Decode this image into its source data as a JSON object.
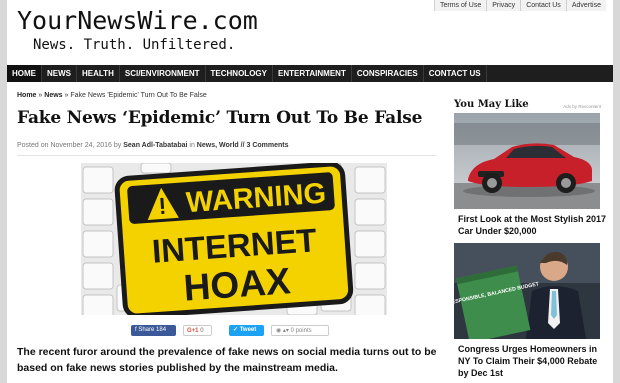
{
  "top_links": [
    "Terms of Use",
    "Privacy",
    "Contact Us",
    "Advertise"
  ],
  "logo": {
    "name": "YourNewsWire.com",
    "tagline": "News. Truth. Unfiltered."
  },
  "nav": [
    "HOME",
    "NEWS",
    "HEALTH",
    "SCI/ENVIRONMENT",
    "TECHNOLOGY",
    "ENTERTAINMENT",
    "CONSPIRACIES",
    "CONTACT US"
  ],
  "breadcrumb": {
    "home": "Home",
    "sep": "»",
    "news": "News",
    "current": "Fake News 'Epidemic' Turn Out To Be False"
  },
  "article": {
    "title": "Fake News ‘Epidemic’ Turn Out To Be False",
    "posted_on": "Posted on November 24, 2016 by",
    "author": "Sean Adl-Tabatabai",
    "in": "in",
    "categories": "News, World",
    "comments": "// 3 Comments",
    "image": {
      "line1": "WARNING",
      "line2": "INTERNET",
      "line3": "HOAX"
    },
    "lead": "The recent furor around the prevalence of fake news on social media turns out to be based on fake news stories published by the mainstream media."
  },
  "share": {
    "facebook_label": "Share",
    "facebook_count": "184",
    "gplus_label": "G+1",
    "gplus_count": "0",
    "tweet_label": "Tweet",
    "stumble_label": "0 points"
  },
  "sidebar": {
    "title": "You May Like",
    "ads_label": "Ads by Revcontent",
    "items": [
      {
        "caption": "First Look at the Most Stylish 2017 Car Under $20,000"
      },
      {
        "caption": "Congress Urges Homeowners in NY To Claim Their $4,000 Rebate by Dec 1st",
        "image_text": "A RESPONSIBLE, BALANCED BUDGET"
      }
    ]
  },
  "colors": {
    "nav": "#1e1e1e",
    "sign_yellow": "#f4d200",
    "car_red": "#c8202a",
    "facebook": "#3b5998",
    "twitter": "#1da1f2"
  }
}
